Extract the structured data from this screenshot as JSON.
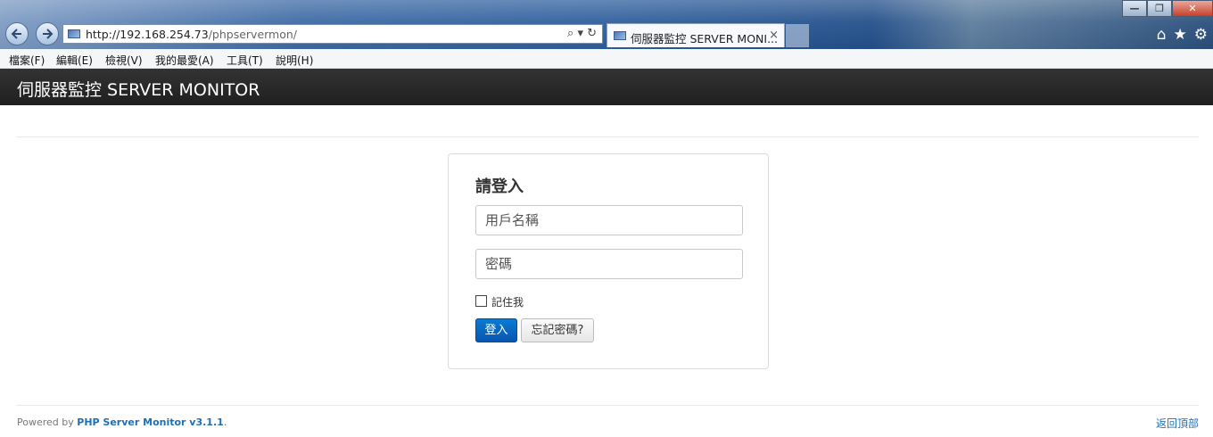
{
  "browser": {
    "url_host": "http://192.168.254.73",
    "url_path": "/phpservermon/",
    "tab_title": "伺服器監控 SERVER MONI...",
    "tab_close": "×",
    "url_tools": "⌕ ▾ ↻",
    "window_buttons": {
      "minimize": "—",
      "maximize": "❐",
      "close": "✕"
    },
    "toolbar_icons": {
      "home": "⌂",
      "favorites": "★",
      "tools": "⚙"
    }
  },
  "menu": [
    "檔案(F)",
    "編輯(E)",
    "檢視(V)",
    "我的最愛(A)",
    "工具(T)",
    "說明(H)"
  ],
  "navbar": {
    "brand": "伺服器監控 SERVER MONITOR"
  },
  "login": {
    "title": "請登入",
    "username_placeholder": "用戶名稱",
    "password_placeholder": "密碼",
    "remember_label": "記住我",
    "login_button": "登入",
    "forgot_button": "忘記密碼?"
  },
  "footer": {
    "powered_by": "Powered by ",
    "product_link": "PHP Server Monitor v3.1.1",
    "period": ".",
    "back_to_top": "返回頂部"
  },
  "colors": {
    "primary_button": "#0a7ad4",
    "link": "#1f6fb6",
    "navbar": "#222222"
  }
}
